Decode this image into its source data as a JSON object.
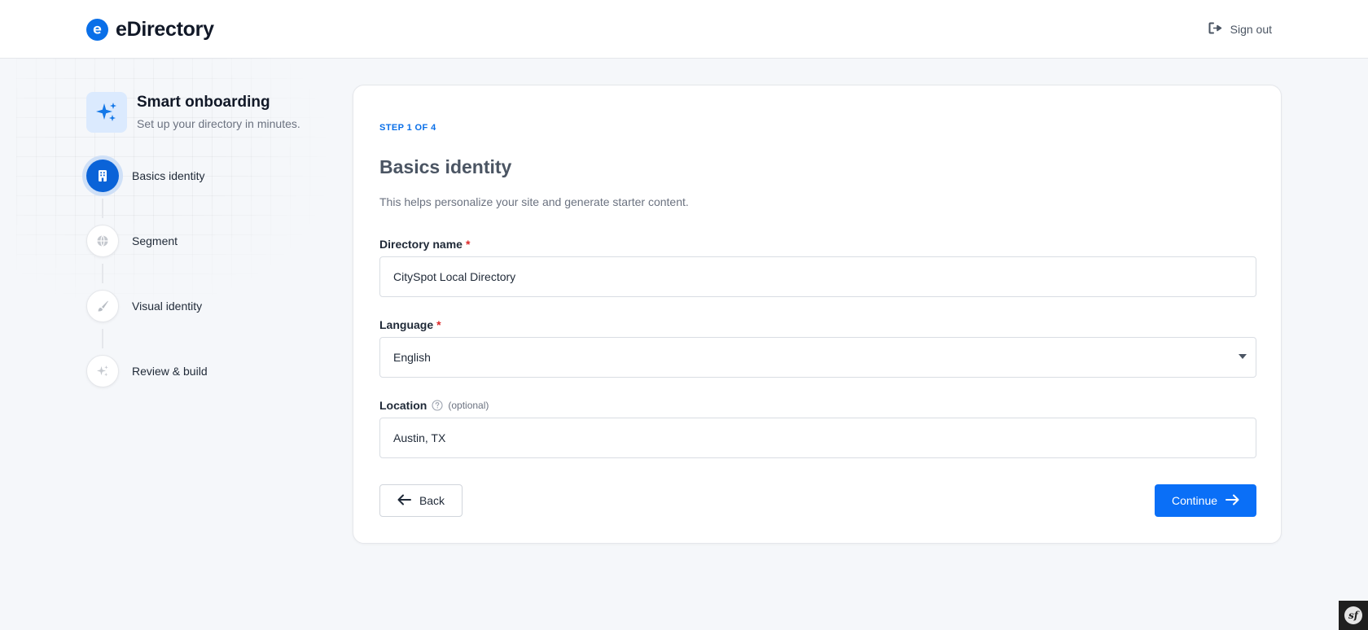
{
  "brand": {
    "name": "eDirectory",
    "accent": "#0a6fe8"
  },
  "header": {
    "signout_label": "Sign out",
    "signout_icon": "sign-out-icon"
  },
  "sidebar": {
    "title": "Smart onboarding",
    "subtitle": "Set up your directory in minutes.",
    "icon": "sparkles-icon",
    "steps": [
      {
        "label": "Basics identity",
        "icon": "building-icon",
        "active": true
      },
      {
        "label": "Segment",
        "icon": "globe-icon",
        "active": false
      },
      {
        "label": "Visual identity",
        "icon": "brush-icon",
        "active": false
      },
      {
        "label": "Review & build",
        "icon": "sparkles-icon",
        "active": false
      }
    ]
  },
  "form": {
    "kicker": "STEP 1 OF 4",
    "title": "Basics identity",
    "description": "This helps personalize your site and generate starter content.",
    "directory_name": {
      "label": "Directory name",
      "required": "*",
      "value": "CitySpot Local Directory"
    },
    "language": {
      "label": "Language",
      "required": "*",
      "value": "English"
    },
    "location": {
      "label": "Location",
      "optional": "(optional)",
      "value": "Austin, TX"
    },
    "back_label": "Back",
    "continue_label": "Continue"
  },
  "debug_badge": {
    "label": "sf"
  }
}
